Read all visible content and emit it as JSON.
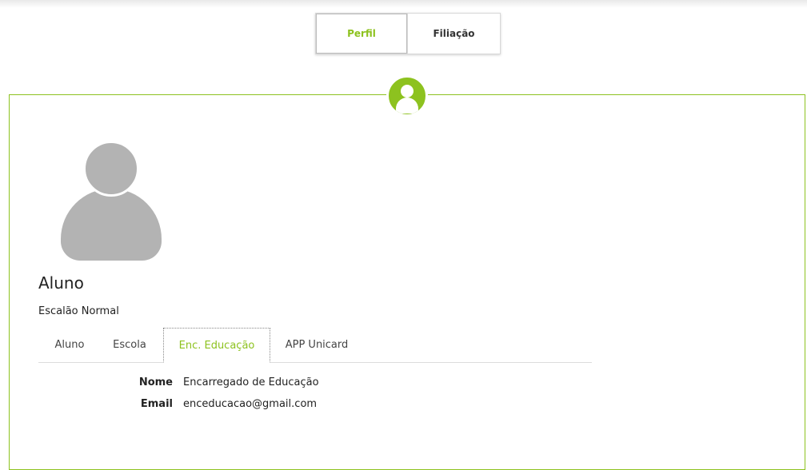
{
  "top_tabs": [
    {
      "label": "Perfil",
      "active": true
    },
    {
      "label": "Filiação",
      "active": false
    }
  ],
  "profile": {
    "name": "Aluno",
    "escalao": "Escalão Normal"
  },
  "sub_tabs": [
    {
      "label": "Aluno",
      "active": false
    },
    {
      "label": "Escola",
      "active": false
    },
    {
      "label": "Enc. Educação",
      "active": true
    },
    {
      "label": "APP Unicard",
      "active": false
    }
  ],
  "details": {
    "nome_label": "Nome",
    "nome_value": "Encarregado de Educação",
    "email_label": "Email",
    "email_value": "enceducacao@gmail.com"
  },
  "colors": {
    "accent": "#8dc21f",
    "avatar": "#b3b3b3"
  }
}
